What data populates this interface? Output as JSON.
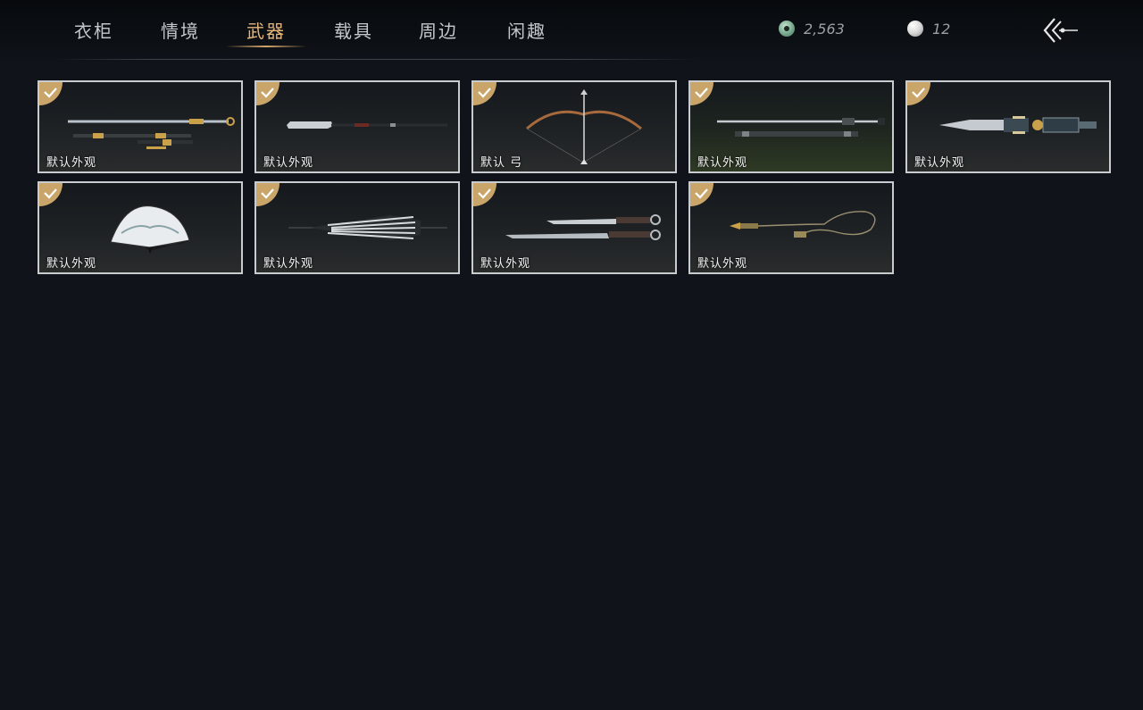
{
  "nav": {
    "tabs": [
      {
        "label": "衣柜"
      },
      {
        "label": "情境"
      },
      {
        "label": "武器"
      },
      {
        "label": "载具"
      },
      {
        "label": "周边"
      },
      {
        "label": "闲趣"
      }
    ],
    "active_tab": "武器"
  },
  "currency": {
    "jade": {
      "icon": "jade-coin-icon",
      "value": "2,563"
    },
    "pearl": {
      "icon": "pearl-icon",
      "value": "12"
    }
  },
  "back": {
    "icon": "back-arrow-icon"
  },
  "items": [
    {
      "label": "默认外观",
      "icon": "sword-icon",
      "selected": true
    },
    {
      "label": "默认外观",
      "icon": "glaive-icon",
      "selected": true
    },
    {
      "label": "默认 弓",
      "icon": "bow-icon",
      "selected": true
    },
    {
      "label": "默认外观",
      "icon": "twin-swords-icon",
      "selected": true
    },
    {
      "label": "默认外观",
      "icon": "blade-gauntlet-icon",
      "selected": true
    },
    {
      "label": "默认外观",
      "icon": "fan-icon",
      "selected": true
    },
    {
      "label": "默认外观",
      "icon": "umbrella-icon",
      "selected": true
    },
    {
      "label": "默认外观",
      "icon": "dual-blades-icon",
      "selected": true
    },
    {
      "label": "默认外观",
      "icon": "rope-dart-icon",
      "selected": true
    }
  ],
  "colors": {
    "accent": "#e6b57a",
    "background": "#10141a",
    "card_border": "#c9ccce",
    "check_badge": "#c9a56a"
  }
}
